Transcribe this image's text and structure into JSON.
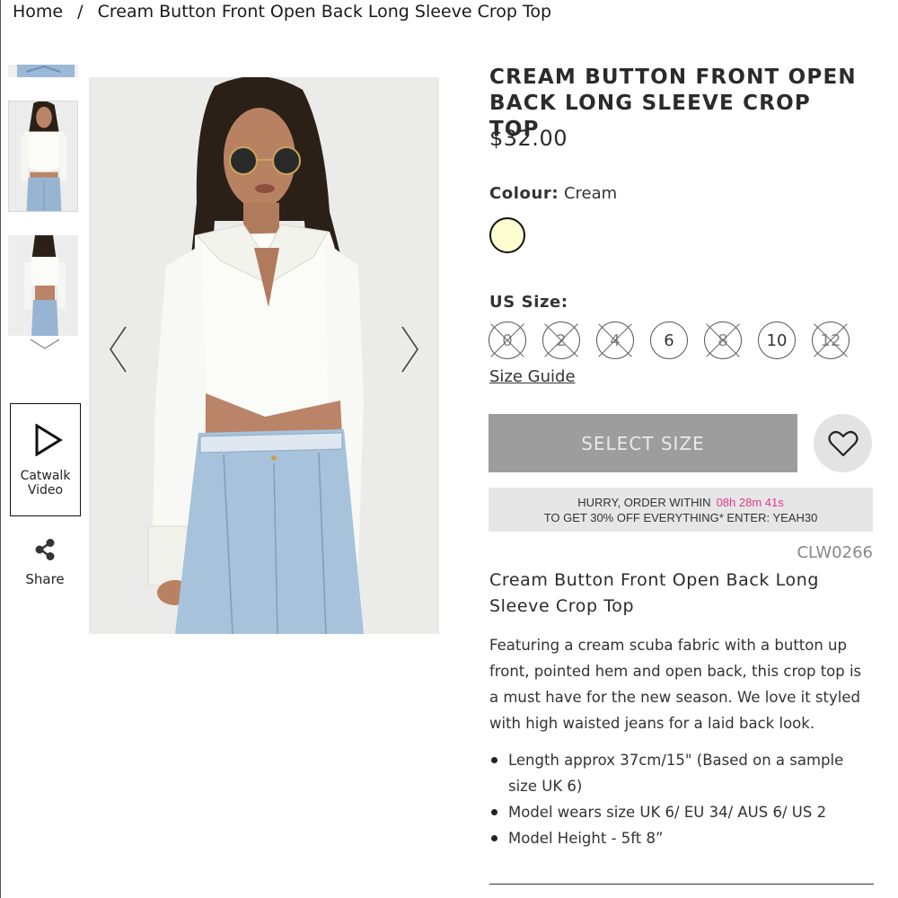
{
  "breadcrumb": {
    "home": "Home",
    "separator": "/",
    "current": "Cream Button Front Open Back Long Sleeve Crop Top"
  },
  "gallery": {
    "thumbnails": [
      {
        "icon": "thumbnail-jeans-crop"
      },
      {
        "icon": "thumbnail-front-view"
      },
      {
        "icon": "thumbnail-back-view"
      }
    ],
    "scroll_down_icon": "chevron-down-icon",
    "catwalk_label": "Catwalk Video",
    "share_label": "Share",
    "prev_icon": "chevron-left-icon",
    "next_icon": "chevron-right-icon"
  },
  "product": {
    "title": "CREAM BUTTON FRONT OPEN BACK LONG SLEEVE CROP TOP",
    "price": "$32.00",
    "colour_label": "Colour:",
    "colour_value": "Cream",
    "swatch_color": "#fdfdd2",
    "size_label": "US Size:",
    "sizes": [
      {
        "label": "0",
        "available": false
      },
      {
        "label": "2",
        "available": false
      },
      {
        "label": "4",
        "available": false
      },
      {
        "label": "6",
        "available": true
      },
      {
        "label": "8",
        "available": false
      },
      {
        "label": "10",
        "available": true
      },
      {
        "label": "12",
        "available": false
      }
    ],
    "size_guide": "Size Guide",
    "select_size": "SELECT SIZE",
    "wishlist_icon": "heart-icon",
    "promo": {
      "line1_prefix": "HURRY, ORDER WITHIN",
      "timer": "08h 28m 41s",
      "line2": "TO GET 30% OFF EVERYTHING* ENTER: YEAH30"
    },
    "sku": "CLW0266",
    "description_title": "Cream Button Front Open Back Long Sleeve Crop Top",
    "description": "Featuring a cream scuba fabric with a button up front, pointed hem and open back, this crop top is a must have for the new season. We love it styled with high waisted jeans for a laid back look.",
    "bullets": [
      "Length approx 37cm/15\" (Based on a sample size UK 6)",
      "Model wears size UK 6/ EU 34/ AUS 6/ US 2",
      "Model Height - 5ft 8”"
    ]
  },
  "colors": {
    "button_disabled": "#9d9d9d",
    "promo_bg": "#e6e6e6",
    "timer": "#e5388b"
  }
}
